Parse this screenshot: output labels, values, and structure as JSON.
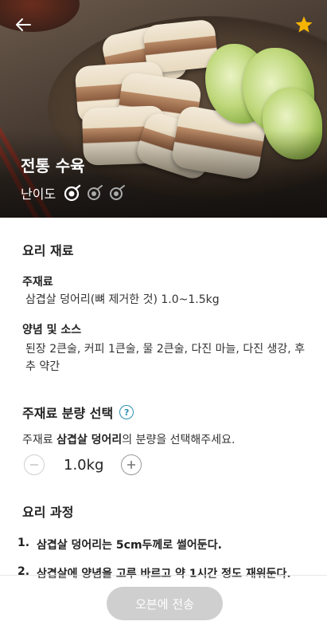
{
  "header": {
    "back_icon": "arrow-left-icon",
    "favorite_icon": "star-icon",
    "favorite_color": "#f4b400"
  },
  "recipe": {
    "title": "전통 수육",
    "difficulty_label": "난이도",
    "difficulty_level": 1,
    "difficulty_max": 3
  },
  "ingredients": {
    "section_title": "요리 재료",
    "main_title": "주재료",
    "main_text": "삼겹살 덩어리(뼈 제거한 것) 1.0~1.5kg",
    "sauce_title": "양념 및 소스",
    "sauce_text": "된장 2큰술, 커피 1큰술, 물 2큰술, 다진 마늘, 다진 생강, 후추 약간"
  },
  "quantity": {
    "section_title": "주재료 분량 선택",
    "help_icon": "question-circle-icon",
    "help_color": "#2b8fb3",
    "desc_prefix": "주재료 ",
    "desc_highlight": "삼겹살 덩어리",
    "desc_suffix": "의 분량을 선택해주세요.",
    "value": "1.0kg",
    "minus_icon": "minus-icon",
    "plus_icon": "plus-icon"
  },
  "process": {
    "section_title": "요리 과정",
    "steps": [
      {
        "num": "1.",
        "text": "삼겹살 덩어리는 5cm두께로 썰어둔다."
      },
      {
        "num": "2.",
        "text": "삼겹살에 양념을 고루 바르고 약 1시간 정도 재워둔다."
      }
    ]
  },
  "footer": {
    "send_label": "오븐에 전송"
  }
}
